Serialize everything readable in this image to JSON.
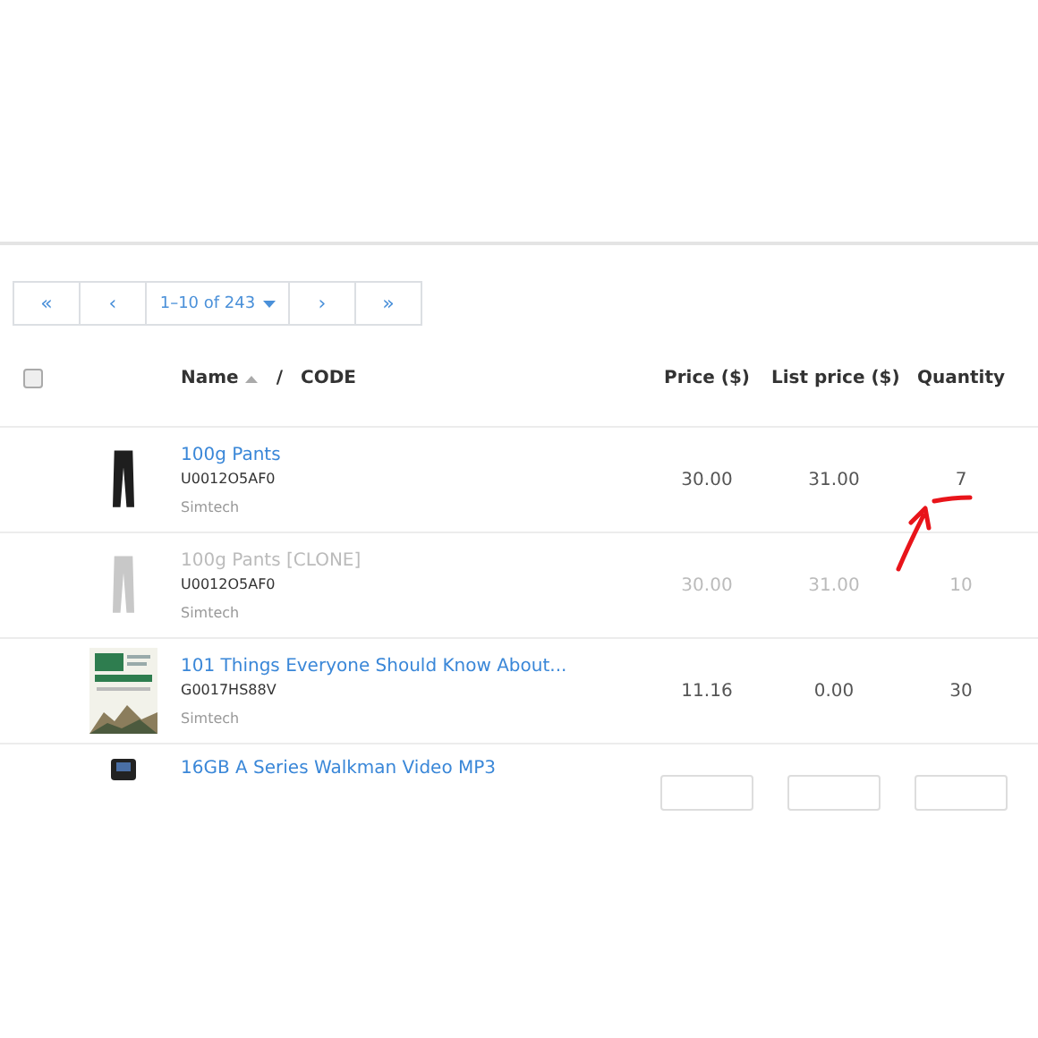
{
  "pager": {
    "first": "«",
    "prev": "‹",
    "range": "1–10 of 243",
    "next": "›",
    "last": "»"
  },
  "columns": {
    "name": "Name",
    "separator": "/",
    "code": "CODE",
    "price": "Price ($)",
    "list_price": "List price ($)",
    "quantity": "Quantity"
  },
  "select_all": {
    "checked": false
  },
  "rows": [
    {
      "name": "100g Pants",
      "code": "U0012O5AF0",
      "vendor": "Simtech",
      "price": "30.00",
      "list_price": "31.00",
      "quantity": "7",
      "disabled": false,
      "kind": "garment"
    },
    {
      "name": "100g Pants [CLONE]",
      "code": "U0012O5AF0",
      "vendor": "Simtech",
      "price": "30.00",
      "list_price": "31.00",
      "quantity": "10",
      "disabled": true,
      "kind": "garment"
    },
    {
      "name": "101 Things Everyone Should Know About...",
      "code": "G0017HS88V",
      "vendor": "Simtech",
      "price": "11.16",
      "list_price": "0.00",
      "quantity": "30",
      "disabled": false,
      "kind": "book"
    },
    {
      "name": "16GB A Series Walkman Video MP3",
      "disabled": false,
      "kind": "player"
    }
  ]
}
